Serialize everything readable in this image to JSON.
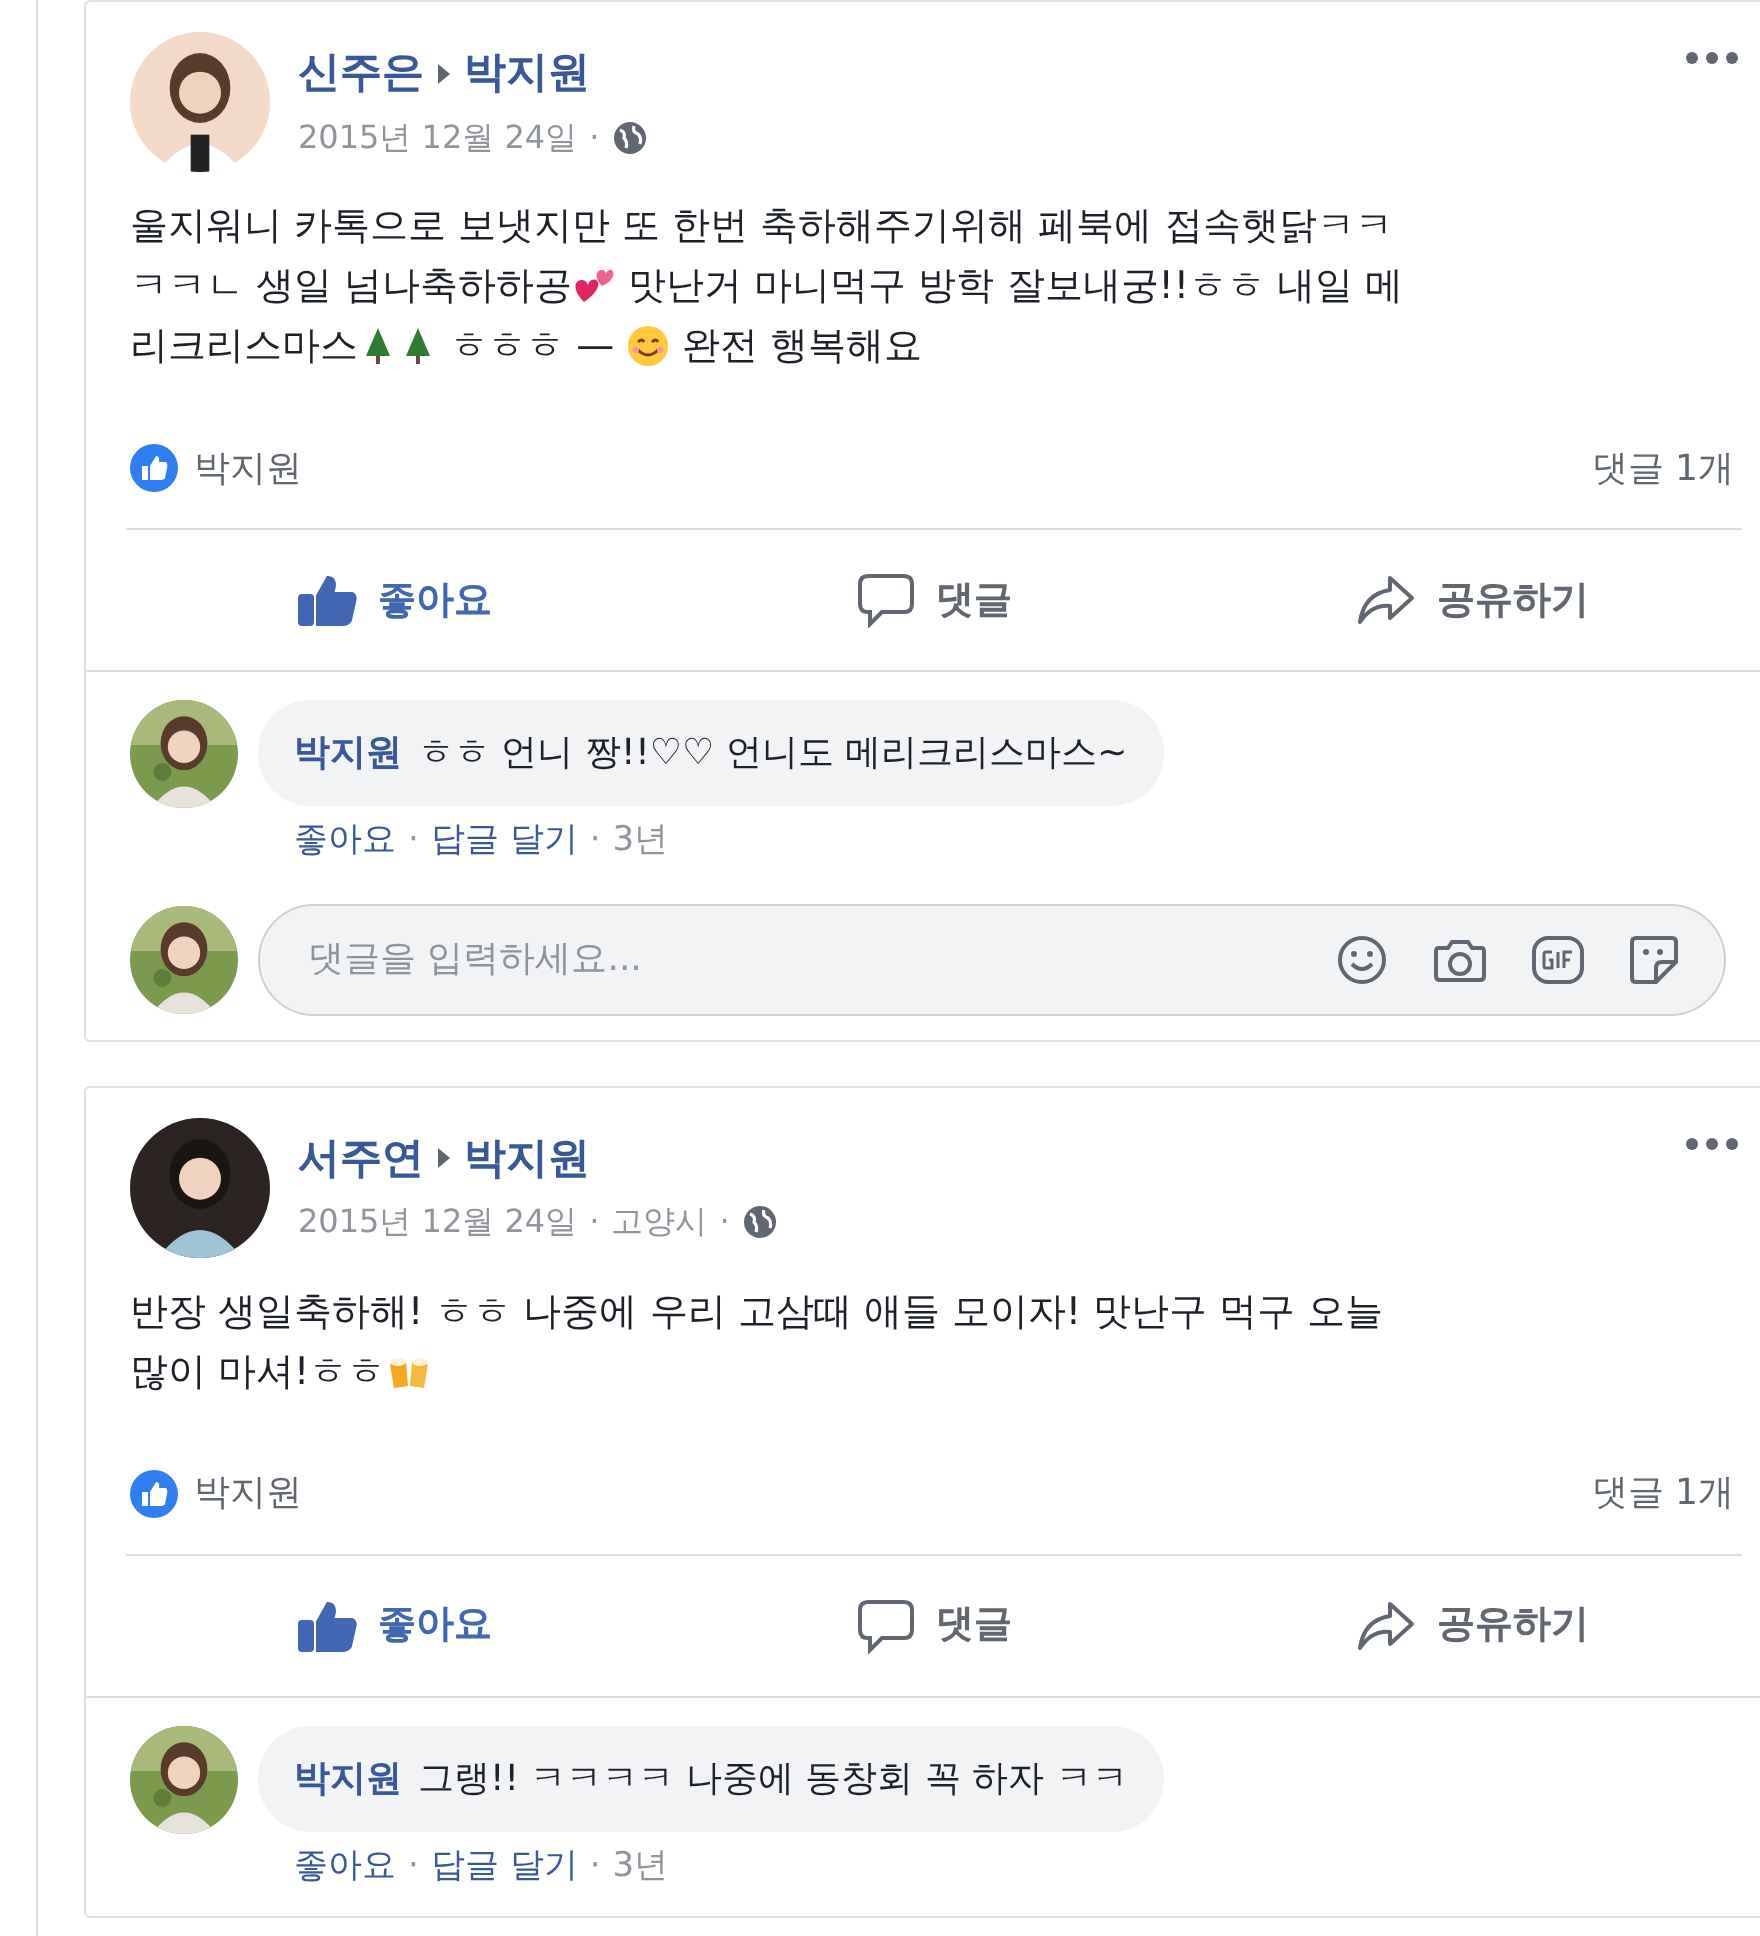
{
  "posts": [
    {
      "author": "신주은",
      "target": "박지원",
      "meta": [
        {
          "kind": "date",
          "text": "2015년 12월 24일"
        },
        {
          "kind": "dot",
          "text": "·"
        },
        {
          "kind": "globe"
        }
      ],
      "body": [
        [
          {
            "kind": "text",
            "text": "울지워니 카톡으로 보냇지만 또 한번 축하해주기위해 페북에 접속햇닭ㅋㅋ"
          }
        ],
        [
          {
            "kind": "text",
            "text": "ㅋㅋㄴ 생일 넘나축하하공"
          },
          {
            "kind": "hearts"
          },
          {
            "kind": "text",
            "text": " 맛난거 마니먹구 방학 잘보내궁!!ㅎㅎ 내일 메"
          }
        ],
        [
          {
            "kind": "text",
            "text": "리크리스마스"
          },
          {
            "kind": "tree"
          },
          {
            "kind": "tree"
          },
          {
            "kind": "text",
            "text": " ㅎㅎㅎ — "
          },
          {
            "kind": "smile"
          },
          {
            "kind": "text",
            "text": " 완전 행복해요"
          }
        ]
      ],
      "likers": "박지원",
      "comment_count": "댓글 1개",
      "actions": [
        {
          "kind": "like",
          "label": "좋아요",
          "selected": true
        },
        {
          "kind": "comment",
          "label": "댓글",
          "selected": false
        },
        {
          "kind": "share",
          "label": "공유하기",
          "selected": false
        }
      ],
      "comments": [
        {
          "author": "박지원",
          "text": "ㅎㅎ 언니 짱!!♡♡ 언니도 메리크리스마스~",
          "meta": [
            {
              "kind": "link",
              "text": "좋아요"
            },
            {
              "kind": "dot",
              "text": "·"
            },
            {
              "kind": "link",
              "text": "답글 달기"
            },
            {
              "kind": "dot",
              "text": "·"
            },
            {
              "kind": "time",
              "text": "3년"
            }
          ]
        }
      ],
      "composer": {
        "placeholder": "댓글을 입력하세요..."
      }
    },
    {
      "author": "서주연",
      "target": "박지원",
      "meta": [
        {
          "kind": "date",
          "text": "2015년 12월 24일"
        },
        {
          "kind": "dot",
          "text": "·"
        },
        {
          "kind": "location",
          "text": "고양시"
        },
        {
          "kind": "dot",
          "text": "·"
        },
        {
          "kind": "globe"
        }
      ],
      "body": [
        [
          {
            "kind": "text",
            "text": "반장 생일축하해! ㅎㅎ 나중에 우리 고삼때 애들 모이자! 맛난구 먹구 오늘"
          }
        ],
        [
          {
            "kind": "text",
            "text": "많이 마셔!ㅎㅎ"
          },
          {
            "kind": "cheers"
          }
        ]
      ],
      "likers": "박지원",
      "comment_count": "댓글 1개",
      "actions": [
        {
          "kind": "like",
          "label": "좋아요",
          "selected": true
        },
        {
          "kind": "comment",
          "label": "댓글",
          "selected": false
        },
        {
          "kind": "share",
          "label": "공유하기",
          "selected": false
        }
      ],
      "comments": [
        {
          "author": "박지원",
          "text": "그랭!! ㅋㅋㅋㅋ 나중에 동창회 꼭 하자 ㅋㅋ",
          "meta": [
            {
              "kind": "link",
              "text": "좋아요"
            },
            {
              "kind": "dot",
              "text": "·"
            },
            {
              "kind": "link",
              "text": "답글 달기"
            },
            {
              "kind": "dot",
              "text": "·"
            },
            {
              "kind": "time",
              "text": "3년"
            }
          ]
        }
      ]
    }
  ]
}
